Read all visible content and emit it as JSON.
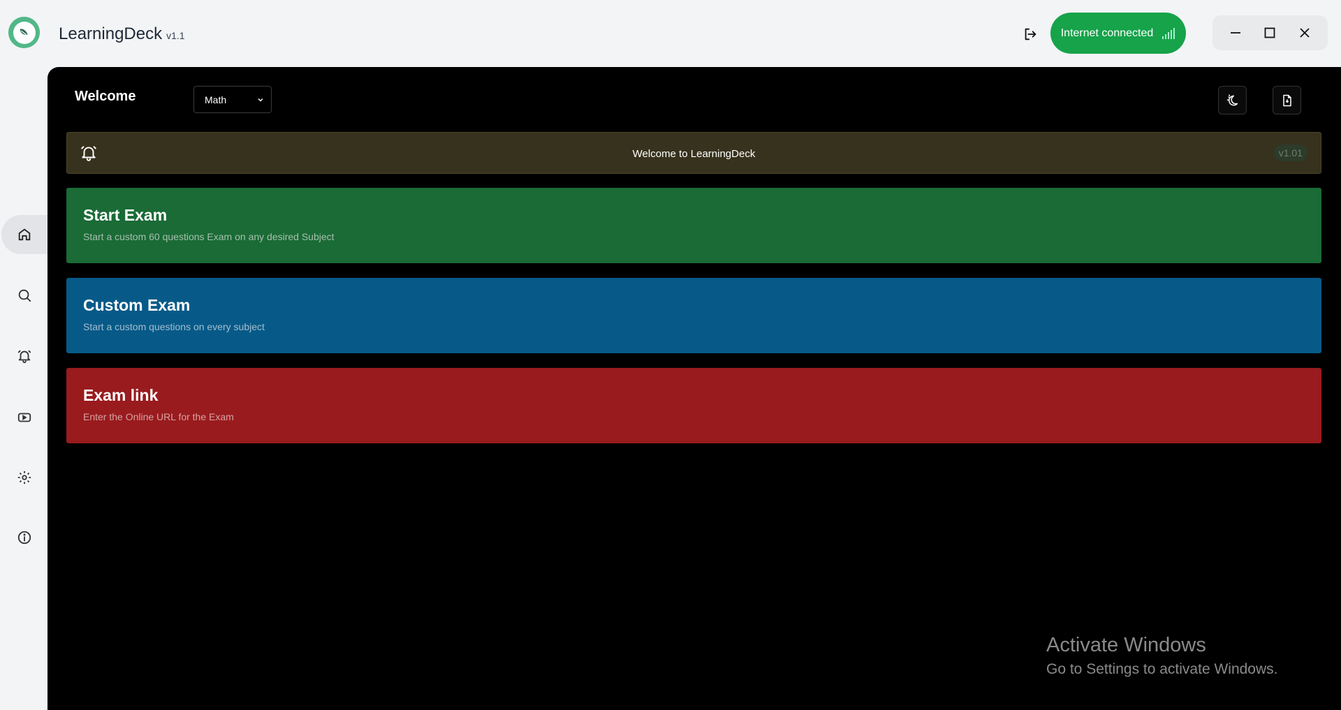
{
  "app": {
    "title": "LearningDeck",
    "version": "v1.1"
  },
  "titlebar": {
    "logout_icon": "logout-icon",
    "internet_status": "Internet connected",
    "signal_icon": "signal-bars-icon",
    "status_color": "#16a34a",
    "window_controls": [
      "minimize-icon",
      "maximize-icon",
      "close-icon"
    ]
  },
  "sidebar": {
    "items": [
      {
        "name": "home",
        "icon": "home-icon",
        "active": true
      },
      {
        "name": "search",
        "icon": "search-icon",
        "active": false
      },
      {
        "name": "notifications",
        "icon": "bell-icon",
        "active": false
      },
      {
        "name": "videos",
        "icon": "youtube-icon",
        "active": false
      },
      {
        "name": "settings",
        "icon": "gear-icon",
        "active": false
      },
      {
        "name": "info",
        "icon": "info-icon",
        "active": false
      }
    ]
  },
  "main": {
    "welcome": "Welcome",
    "subject_select": {
      "selected": "Math"
    },
    "tools": [
      "theme-toggle-icon",
      "file-icon"
    ],
    "notice": {
      "text": "Welcome to LearningDeck",
      "badge": "v1.01"
    },
    "cards": [
      {
        "title": "Start Exam",
        "description": "Start a custom 60 questions Exam on any desired Subject",
        "color": "#1a6b36"
      },
      {
        "title": "Custom Exam",
        "description": "Start a custom questions on every subject",
        "color": "#075a88"
      },
      {
        "title": "Exam link",
        "description": "Enter the Online URL for the Exam",
        "color": "#991b1e"
      }
    ]
  },
  "watermark": {
    "title": "Activate Windows",
    "subtitle": "Go to Settings to activate Windows."
  }
}
